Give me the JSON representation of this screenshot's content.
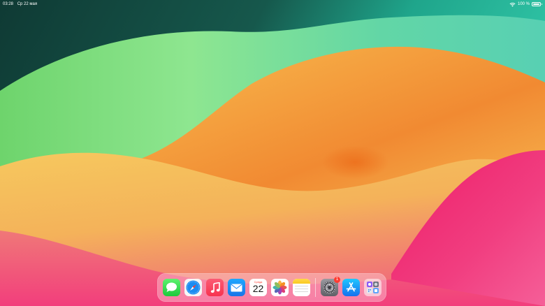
{
  "status_bar": {
    "time": "03:28",
    "date": "Ср 22 мая",
    "battery": "100 %",
    "battery_level": 1.0,
    "wifi_icon": "wifi-icon",
    "battery_icon": "battery-icon"
  },
  "dock": {
    "apps": [
      {
        "name": "Messages",
        "icon": "messages-icon"
      },
      {
        "name": "Safari",
        "icon": "safari-icon"
      },
      {
        "name": "Music",
        "icon": "music-icon"
      },
      {
        "name": "Mail",
        "icon": "mail-icon"
      },
      {
        "name": "Calendar",
        "icon": "calendar-icon",
        "day_label": "Среда",
        "date": "22"
      },
      {
        "name": "Photos",
        "icon": "photos-icon"
      },
      {
        "name": "Notes",
        "icon": "notes-icon"
      }
    ],
    "recent_apps": [
      {
        "name": "Settings",
        "icon": "settings-icon",
        "badge": "1"
      },
      {
        "name": "App Store",
        "icon": "app-store-icon"
      },
      {
        "name": "App Library",
        "icon": "app-library-icon"
      }
    ]
  },
  "colors": {
    "wallpaper_dark_green": "#0f3a34",
    "wallpaper_teal": "#22b89a",
    "wallpaper_green": "#7ee08a",
    "wallpaper_orange": "#f39a3c",
    "wallpaper_yellow": "#f6cf5e",
    "wallpaper_pink": "#f2457f",
    "badge": "#ff3b30"
  }
}
